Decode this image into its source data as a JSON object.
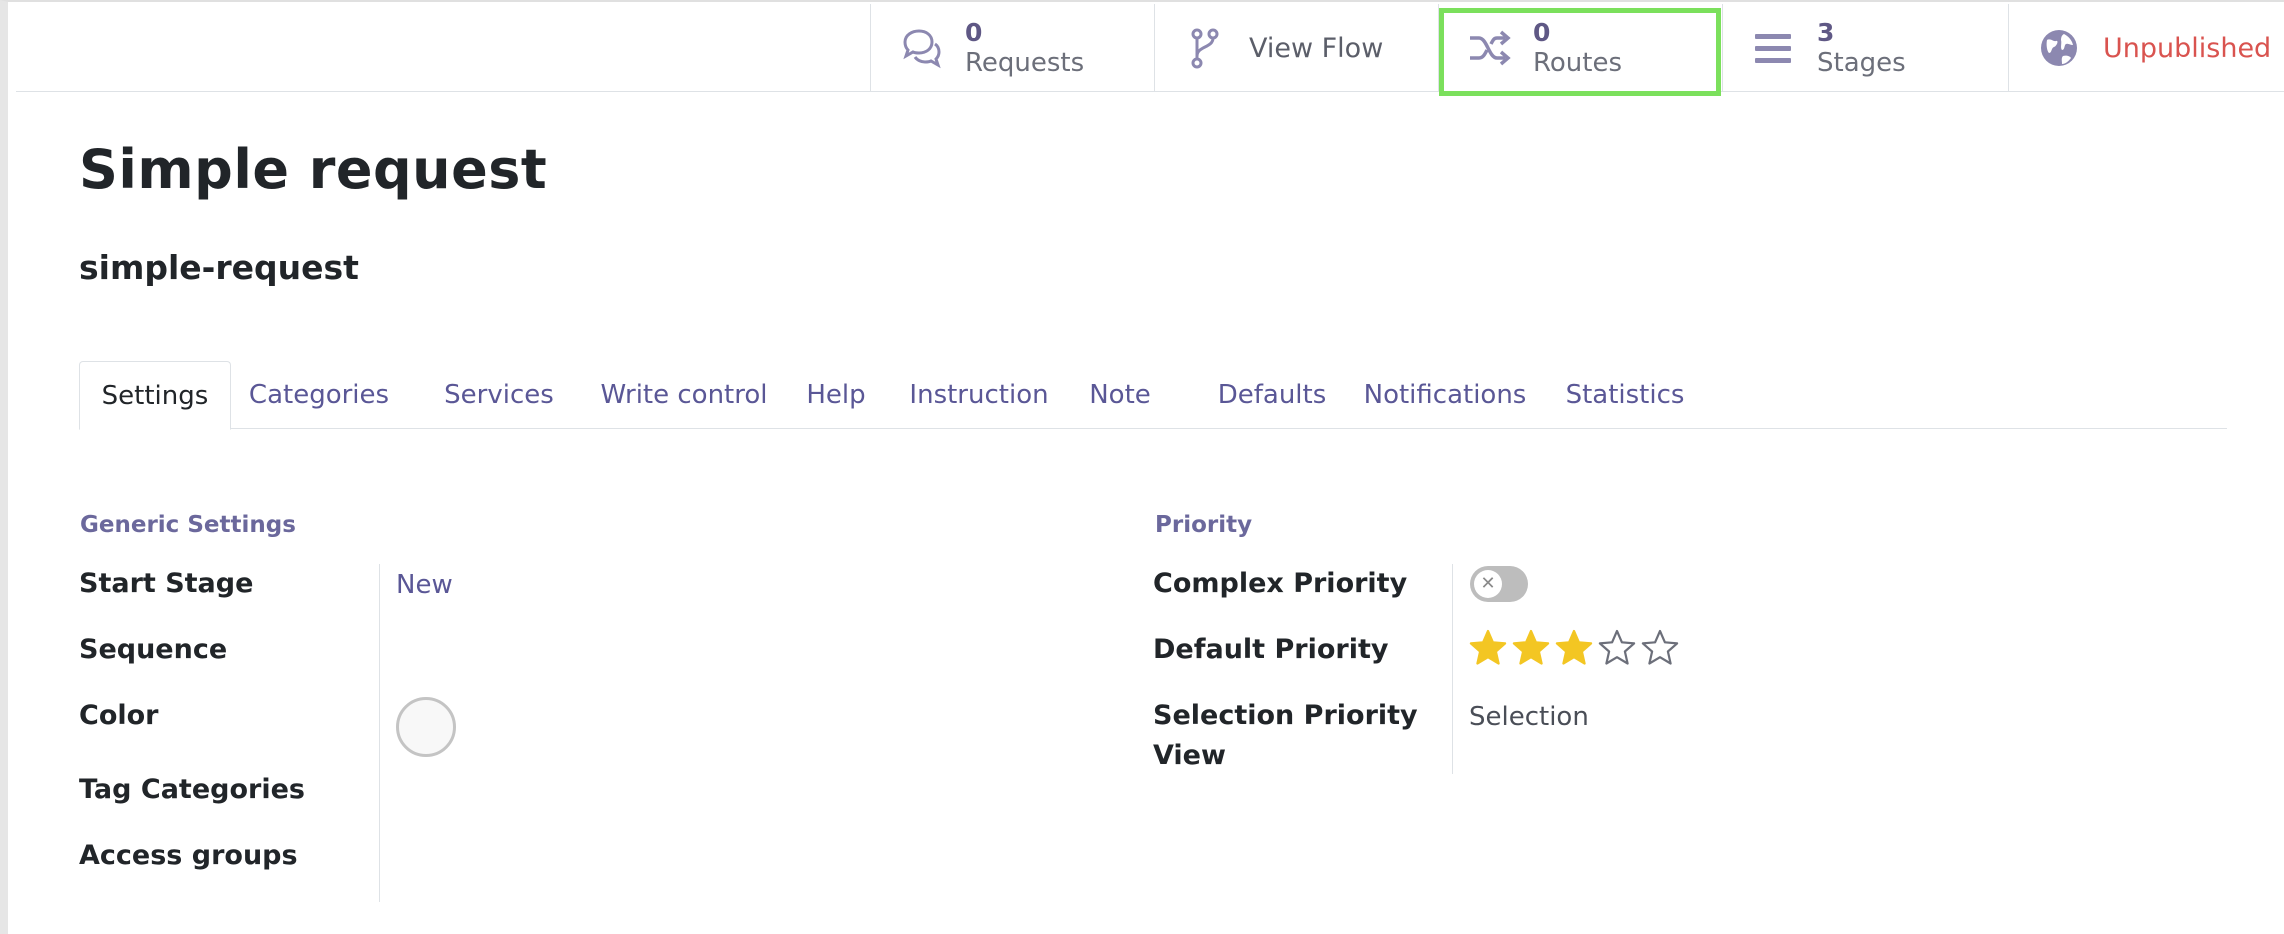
{
  "button_box": {
    "requests": {
      "value": "0",
      "label": "Requests",
      "icon": "comments-icon"
    },
    "view_flow": {
      "label": "View Flow",
      "icon": "code-fork-icon"
    },
    "routes": {
      "value": "0",
      "label": "Routes",
      "icon": "random-icon"
    },
    "stages": {
      "value": "3",
      "label": "Stages",
      "icon": "bars-icon"
    },
    "unpublished": {
      "label": "Unpublished",
      "icon": "globe-icon"
    }
  },
  "record": {
    "title": "Simple request",
    "code": "simple-request"
  },
  "tabs": [
    {
      "label": "Settings",
      "active": true
    },
    {
      "label": "Categories"
    },
    {
      "label": "Services"
    },
    {
      "label": "Write control"
    },
    {
      "label": "Help"
    },
    {
      "label": "Instruction"
    },
    {
      "label": "Note"
    },
    {
      "label": "Defaults"
    },
    {
      "label": "Notifications"
    },
    {
      "label": "Statistics"
    }
  ],
  "generic_settings": {
    "title": "Generic Settings",
    "start_stage_label": "Start Stage",
    "start_stage_value": "New",
    "sequence_label": "Sequence",
    "color_label": "Color",
    "tag_categories_label": "Tag Categories",
    "access_groups_label": "Access groups"
  },
  "priority": {
    "title": "Priority",
    "complex_priority_label": "Complex Priority",
    "complex_priority_enabled": false,
    "default_priority_label": "Default Priority",
    "default_priority_stars": 3,
    "default_priority_max": 5,
    "selection_view_label_line1": "Selection Priority",
    "selection_view_label_line2": "View",
    "selection_view_value": "Selection"
  },
  "colors": {
    "accent": "#5a5796",
    "unpublished": "#d9534f",
    "star_filled": "#f3c623",
    "highlight": "#7be05c"
  }
}
